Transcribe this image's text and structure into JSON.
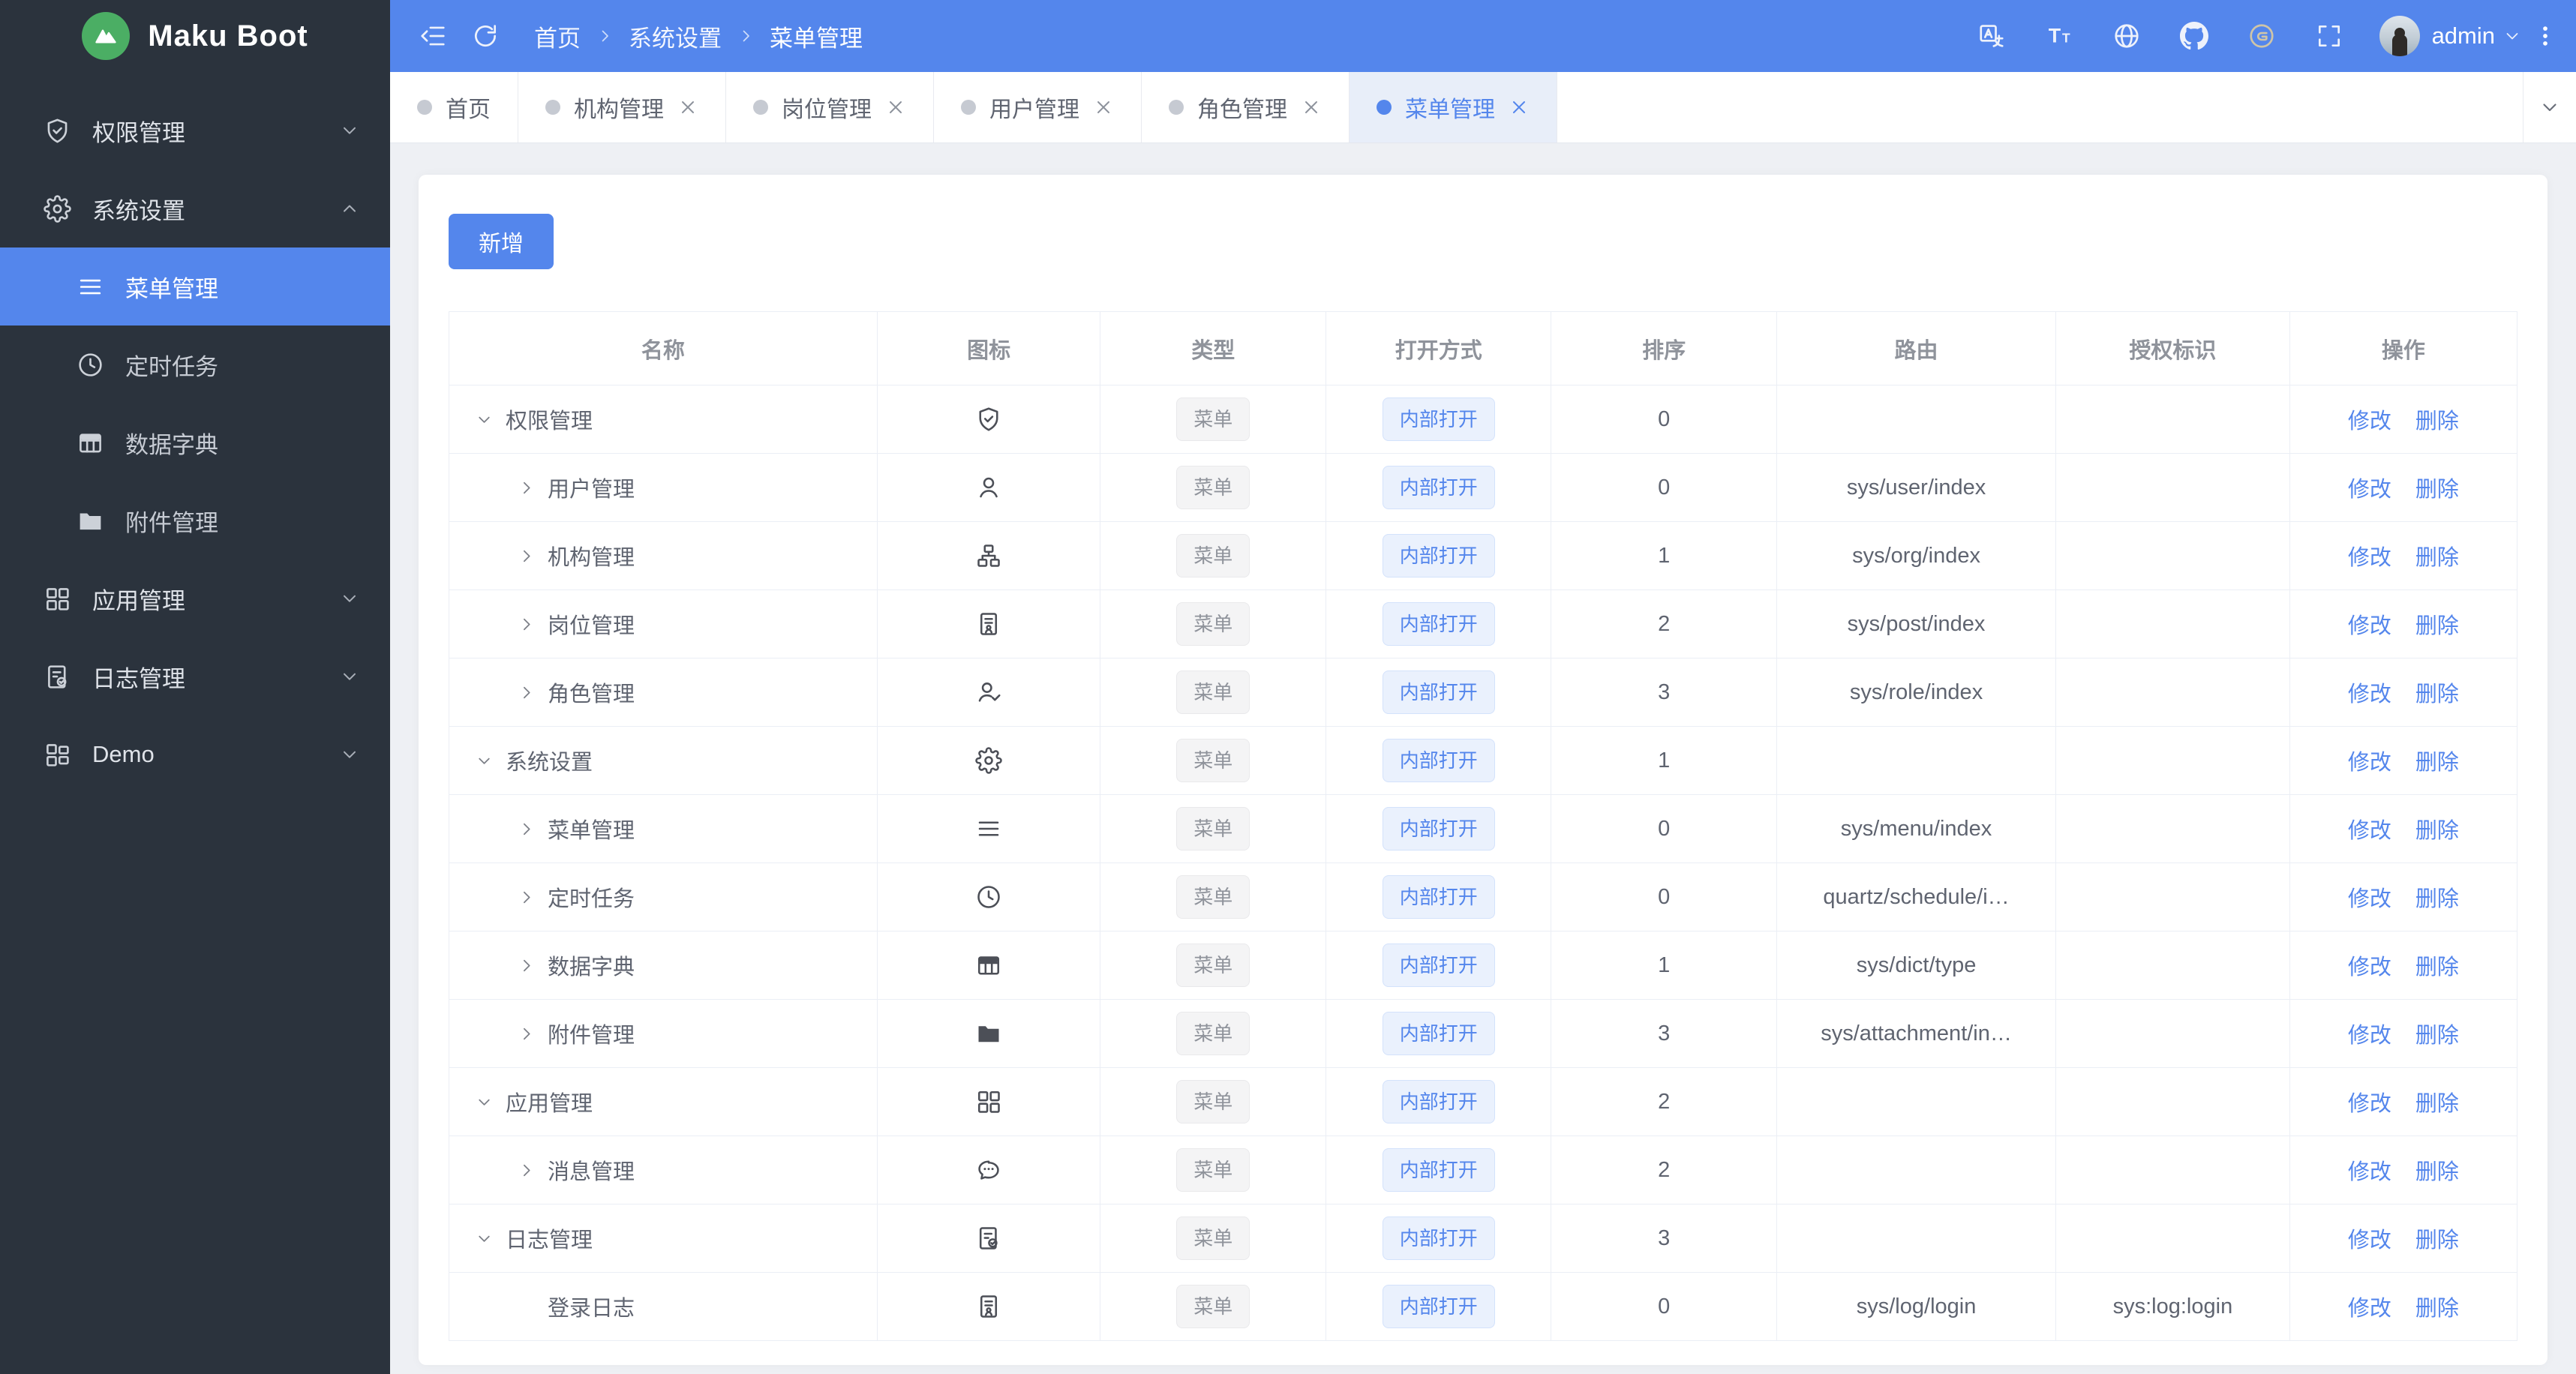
{
  "app": {
    "title": "Maku Boot"
  },
  "colors": {
    "primary": "#5486ec",
    "sidebar_bg": "#2b333d",
    "content_bg": "#eef0f4",
    "logo_green": "#4bae64",
    "active_tab_bg": "#e8eef9"
  },
  "topbar": {
    "left_icons": [
      {
        "name": "collapse-menu-icon"
      },
      {
        "name": "refresh-icon"
      }
    ],
    "breadcrumb": {
      "items": [
        "首页",
        "系统设置",
        "菜单管理"
      ]
    },
    "right_icons": [
      {
        "name": "translate-icon"
      },
      {
        "name": "font-size-icon"
      },
      {
        "name": "globe-icon"
      },
      {
        "name": "github-icon"
      },
      {
        "name": "gitee-icon"
      },
      {
        "name": "fullscreen-icon"
      }
    ],
    "user": {
      "name": "admin"
    }
  },
  "sidebar": {
    "items": [
      {
        "label": "权限管理",
        "icon": "shield-check-icon",
        "level": 1,
        "arrow": "down",
        "active": false
      },
      {
        "label": "系统设置",
        "icon": "gear-icon",
        "level": 1,
        "arrow": "up",
        "active": false
      },
      {
        "label": "菜单管理",
        "icon": "menu-lines-icon",
        "level": 2,
        "arrow": null,
        "active": true
      },
      {
        "label": "定时任务",
        "icon": "clock-icon",
        "level": 2,
        "arrow": null,
        "active": false
      },
      {
        "label": "数据字典",
        "icon": "dict-table-icon",
        "level": 2,
        "arrow": null,
        "active": false
      },
      {
        "label": "附件管理",
        "icon": "folder-filled-icon",
        "level": 2,
        "arrow": null,
        "active": false
      },
      {
        "label": "应用管理",
        "icon": "apps-grid-icon",
        "level": 1,
        "arrow": "down",
        "active": false
      },
      {
        "label": "日志管理",
        "icon": "log-doc-icon",
        "level": 1,
        "arrow": "down",
        "active": false
      },
      {
        "label": "Demo",
        "icon": "demo-grid-icon",
        "level": 1,
        "arrow": "down",
        "active": false
      }
    ]
  },
  "tabbar": {
    "tabs": [
      {
        "label": "首页",
        "closable": false,
        "active": false
      },
      {
        "label": "机构管理",
        "closable": true,
        "active": false
      },
      {
        "label": "岗位管理",
        "closable": true,
        "active": false
      },
      {
        "label": "用户管理",
        "closable": true,
        "active": false
      },
      {
        "label": "角色管理",
        "closable": true,
        "active": false
      },
      {
        "label": "菜单管理",
        "closable": true,
        "active": true
      }
    ]
  },
  "toolbar": {
    "add_label": "新增"
  },
  "table": {
    "headers": [
      "名称",
      "图标",
      "类型",
      "打开方式",
      "排序",
      "路由",
      "授权标识",
      "操作"
    ],
    "ops": {
      "edit": "修改",
      "delete": "删除"
    },
    "rows": [
      {
        "name": "权限管理",
        "level": 0,
        "expand": "down",
        "icon": "shield-check-icon",
        "type": "菜单",
        "open": "内部打开",
        "sort": "0",
        "route": "",
        "perm": ""
      },
      {
        "name": "用户管理",
        "level": 1,
        "expand": "right",
        "icon": "user-icon",
        "type": "菜单",
        "open": "内部打开",
        "sort": "0",
        "route": "sys/user/index",
        "perm": ""
      },
      {
        "name": "机构管理",
        "level": 1,
        "expand": "right",
        "icon": "org-tree-icon",
        "type": "菜单",
        "open": "内部打开",
        "sort": "1",
        "route": "sys/org/index",
        "perm": ""
      },
      {
        "name": "岗位管理",
        "level": 1,
        "expand": "right",
        "icon": "badge-icon",
        "type": "菜单",
        "open": "内部打开",
        "sort": "2",
        "route": "sys/post/index",
        "perm": ""
      },
      {
        "name": "角色管理",
        "level": 1,
        "expand": "right",
        "icon": "user-check-icon",
        "type": "菜单",
        "open": "内部打开",
        "sort": "3",
        "route": "sys/role/index",
        "perm": ""
      },
      {
        "name": "系统设置",
        "level": 0,
        "expand": "down",
        "icon": "gear-icon",
        "type": "菜单",
        "open": "内部打开",
        "sort": "1",
        "route": "",
        "perm": ""
      },
      {
        "name": "菜单管理",
        "level": 1,
        "expand": "right",
        "icon": "menu-lines-icon",
        "type": "菜单",
        "open": "内部打开",
        "sort": "0",
        "route": "sys/menu/index",
        "perm": ""
      },
      {
        "name": "定时任务",
        "level": 1,
        "expand": "right",
        "icon": "clock-icon",
        "type": "菜单",
        "open": "内部打开",
        "sort": "0",
        "route": "quartz/schedule/i…",
        "perm": ""
      },
      {
        "name": "数据字典",
        "level": 1,
        "expand": "right",
        "icon": "dict-table-icon",
        "type": "菜单",
        "open": "内部打开",
        "sort": "1",
        "route": "sys/dict/type",
        "perm": ""
      },
      {
        "name": "附件管理",
        "level": 1,
        "expand": "right",
        "icon": "folder-filled-icon",
        "type": "菜单",
        "open": "内部打开",
        "sort": "3",
        "route": "sys/attachment/in…",
        "perm": ""
      },
      {
        "name": "应用管理",
        "level": 0,
        "expand": "down",
        "icon": "apps-grid-icon",
        "type": "菜单",
        "open": "内部打开",
        "sort": "2",
        "route": "",
        "perm": ""
      },
      {
        "name": "消息管理",
        "level": 1,
        "expand": "right",
        "icon": "chat-bubble-icon",
        "type": "菜单",
        "open": "内部打开",
        "sort": "2",
        "route": "",
        "perm": ""
      },
      {
        "name": "日志管理",
        "level": 0,
        "expand": "down",
        "icon": "log-doc-icon",
        "type": "菜单",
        "open": "内部打开",
        "sort": "3",
        "route": "",
        "perm": ""
      },
      {
        "name": "登录日志",
        "level": 1,
        "expand": null,
        "icon": "badge-icon",
        "type": "菜单",
        "open": "内部打开",
        "sort": "0",
        "route": "sys/log/login",
        "perm": "sys:log:login"
      }
    ]
  }
}
